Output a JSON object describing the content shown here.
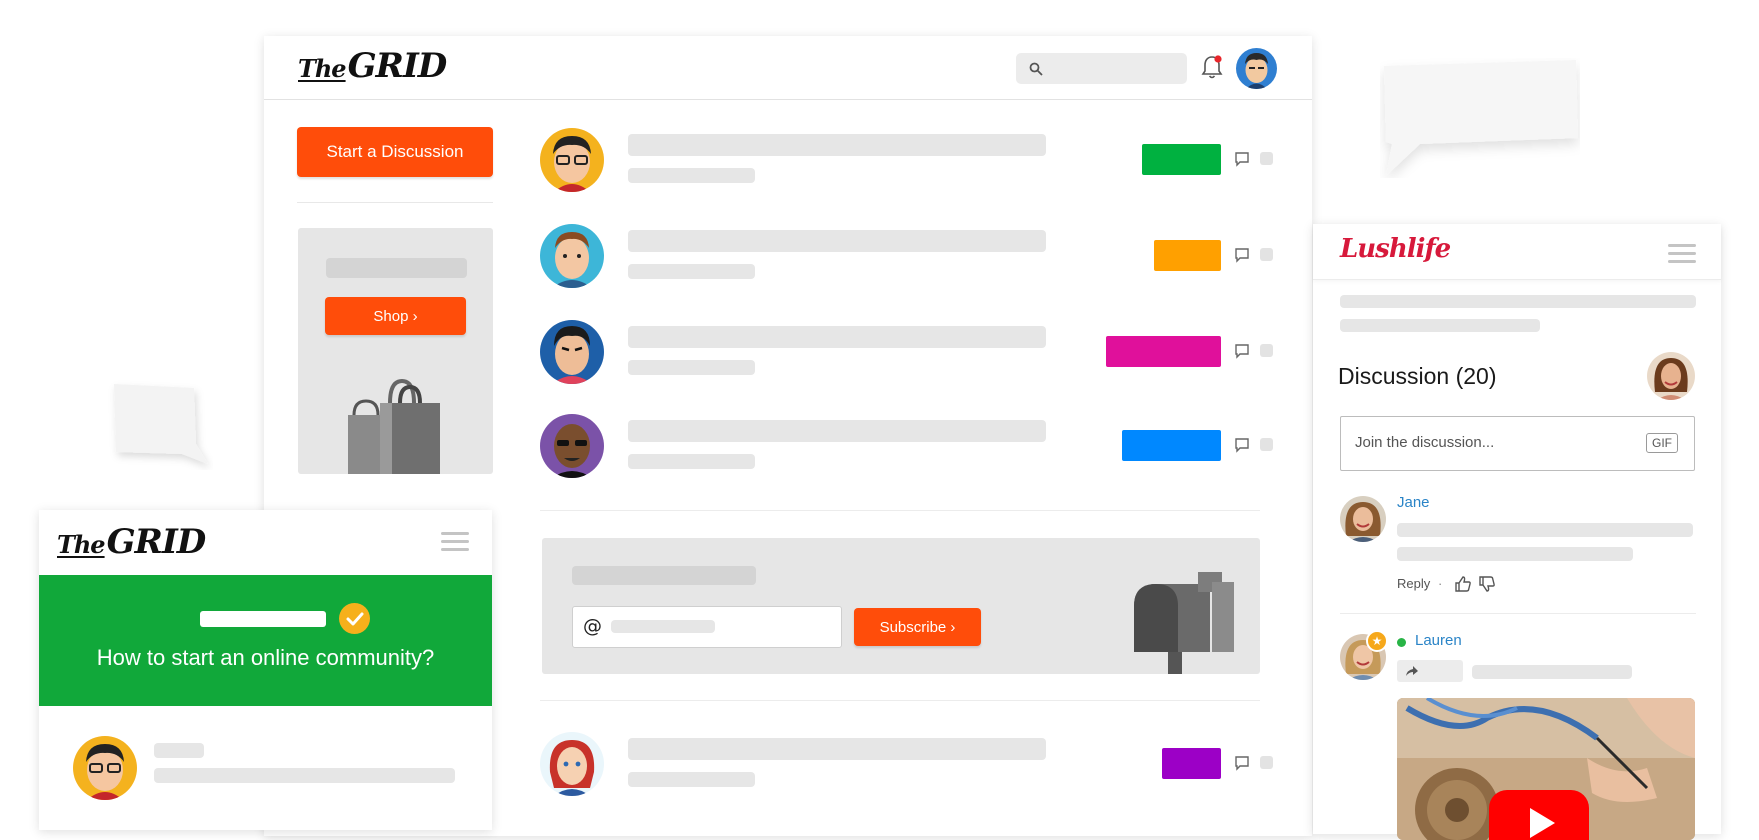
{
  "main_site": {
    "logo": {
      "the": "The",
      "grid": "GRID"
    },
    "search_icon": "search-icon",
    "notification_icon": "bell-icon",
    "start_discussion_label": "Start a Discussion",
    "shop_label": "Shop ›",
    "subscribe_label": "Subscribe ›",
    "email_prefix": "@",
    "tag_colors": [
      "#00b140",
      "#ffa000",
      "#e0109b",
      "#0088ff",
      "#9c00c6"
    ]
  },
  "mobile_site": {
    "logo": {
      "the": "The",
      "grid": "GRID"
    },
    "hero_title": "How to start an online community?",
    "hero_color": "#11a83a"
  },
  "lushlife": {
    "logo": "Lushlife",
    "discussion_title": "Discussion (20)",
    "input_placeholder": "Join the discussion...",
    "gif_label": "GIF",
    "comments": [
      {
        "author": "Jane",
        "reply_label": "Reply",
        "separator": "·"
      },
      {
        "author": "Lauren",
        "online": true
      }
    ]
  }
}
